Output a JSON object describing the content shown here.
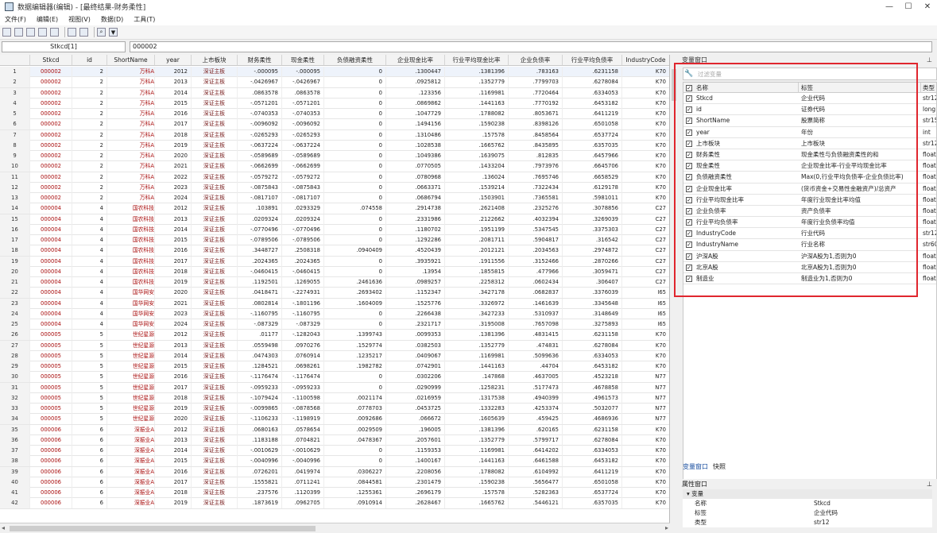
{
  "window": {
    "title": "数据编辑器(编辑) - [最终结果-财务柔性]"
  },
  "menu": [
    "文件(F)",
    "编辑(E)",
    "视图(V)",
    "数据(D)",
    "工具(T)"
  ],
  "varbar": {
    "varname": "Stkcd[1]",
    "value": "000002"
  },
  "columns": [
    "Stkcd",
    "id",
    "ShortName",
    "year",
    "上市板块",
    "财务柔性",
    "现金柔性",
    "负债融资柔性",
    "企业现金比率",
    "行业平均现金比率",
    "企业负债率",
    "行业平均负债率",
    "IndustryCode"
  ],
  "rows": [
    [
      "000002",
      "2",
      "万科A",
      "2012",
      "深证主板",
      "-.000095",
      "-.000095",
      "0",
      ".1300447",
      ".1381396",
      ".783163",
      ".6231158",
      "K70"
    ],
    [
      "000002",
      "2",
      "万科A",
      "2013",
      "深证主板",
      "-.0426967",
      "-.0426967",
      "0",
      ".0925812",
      ".1352779",
      ".7799703",
      ".6278084",
      "K70"
    ],
    [
      "000002",
      "2",
      "万科A",
      "2014",
      "深证主板",
      ".0863578",
      ".0863578",
      "0",
      ".123356",
      ".1169981",
      ".7720464",
      ".6334053",
      "K70"
    ],
    [
      "000002",
      "2",
      "万科A",
      "2015",
      "深证主板",
      "-.0571201",
      "-.0571201",
      "0",
      ".0869862",
      ".1441163",
      ".7770192",
      ".6453182",
      "K70"
    ],
    [
      "000002",
      "2",
      "万科A",
      "2016",
      "深证主板",
      "-.0740353",
      "-.0740353",
      "0",
      ".1047729",
      ".1788082",
      ".8053671",
      ".6411219",
      "K70"
    ],
    [
      "000002",
      "2",
      "万科A",
      "2017",
      "深证主板",
      "-.0096092",
      "-.0096092",
      "0",
      ".1494156",
      ".1590238",
      ".8398126",
      ".6501058",
      "K70"
    ],
    [
      "000002",
      "2",
      "万科A",
      "2018",
      "深证主板",
      "-.0265293",
      "-.0265293",
      "0",
      ".1310486",
      ".157578",
      ".8458564",
      ".6537724",
      "K70"
    ],
    [
      "000002",
      "2",
      "万科A",
      "2019",
      "深证主板",
      "-.0637224",
      "-.0637224",
      "0",
      ".1028538",
      ".1665762",
      ".8435895",
      ".6357035",
      "K70"
    ],
    [
      "000002",
      "2",
      "万科A",
      "2020",
      "深证主板",
      "-.0589689",
      "-.0589689",
      "0",
      ".1049386",
      ".1639075",
      ".812835",
      ".6457966",
      "K70"
    ],
    [
      "000002",
      "2",
      "万科A",
      "2021",
      "深证主板",
      "-.0662699",
      "-.0662699",
      "0",
      ".0770505",
      ".1433204",
      ".7973976",
      ".6645706",
      "K70"
    ],
    [
      "000002",
      "2",
      "万科A",
      "2022",
      "深证主板",
      "-.0579272",
      "-.0579272",
      "0",
      ".0780968",
      ".136024",
      ".7695746",
      ".6658529",
      "K70"
    ],
    [
      "000002",
      "2",
      "万科A",
      "2023",
      "深证主板",
      "-.0875843",
      "-.0875843",
      "0",
      ".0663371",
      ".1539214",
      ".7322434",
      ".6129178",
      "K70"
    ],
    [
      "000002",
      "2",
      "万科A",
      "2024",
      "深证主板",
      "-.0817107",
      "-.0817107",
      "0",
      ".0686794",
      ".1503901",
      ".7365581",
      ".5981011",
      "K70"
    ],
    [
      "000004",
      "4",
      "国农科技",
      "2012",
      "深证主板",
      ".103891",
      ".0293329",
      ".074558",
      ".2914738",
      ".2621408",
      ".2325276",
      ".3078856",
      "C27"
    ],
    [
      "000004",
      "4",
      "国农科技",
      "2013",
      "深证主板",
      ".0209324",
      ".0209324",
      "0",
      ".2331986",
      ".2122662",
      ".4032394",
      ".3269039",
      "C27"
    ],
    [
      "000004",
      "4",
      "国农科技",
      "2014",
      "深证主板",
      "-.0770496",
      "-.0770496",
      "0",
      ".1180702",
      ".1951199",
      ".5347545",
      ".3375303",
      "C27"
    ],
    [
      "000004",
      "4",
      "国农科技",
      "2015",
      "深证主板",
      "-.0789506",
      "-.0789506",
      "0",
      ".1292286",
      ".2081711",
      ".5904817",
      ".316542",
      "C27"
    ],
    [
      "000004",
      "4",
      "国农科技",
      "2016",
      "深证主板",
      ".3448727",
      ".2508318",
      ".0940409",
      ".4520439",
      ".2012121",
      ".2034563",
      ".2974872",
      "C27"
    ],
    [
      "000004",
      "4",
      "国农科技",
      "2017",
      "深证主板",
      ".2024365",
      ".2024365",
      "0",
      ".3935921",
      ".1911556",
      ".3152466",
      ".2870266",
      "C27"
    ],
    [
      "000004",
      "4",
      "国农科技",
      "2018",
      "深证主板",
      "-.0460415",
      "-.0460415",
      "0",
      ".13954",
      ".1855815",
      ".477966",
      ".3059471",
      "C27"
    ],
    [
      "000004",
      "4",
      "国农科技",
      "2019",
      "深证主板",
      ".1192501",
      ".1269055",
      ".2461636",
      ".0989257",
      ".2258312",
      ".0602434",
      ".306407",
      "C27"
    ],
    [
      "000004",
      "4",
      "国华网安",
      "2020",
      "深证主板",
      ".0418471",
      "-.2274931",
      ".2693402",
      ".1152347",
      ".3427178",
      ".0682837",
      ".3376039",
      "I65"
    ],
    [
      "000004",
      "4",
      "国华网安",
      "2021",
      "深证主板",
      ".0802814",
      "-.1801196",
      ".1604009",
      ".1525776",
      ".3326972",
      ".1461639",
      ".3345648",
      "I65"
    ],
    [
      "000004",
      "4",
      "国华网安",
      "2023",
      "深证主板",
      "-.1160795",
      "-.1160795",
      "0",
      ".2266438",
      ".3427233",
      ".5310937",
      ".3148649",
      "I65"
    ],
    [
      "000004",
      "4",
      "国华网安",
      "2024",
      "深证主板",
      "-.087329",
      "-.087329",
      "0",
      ".2321717",
      ".3195008",
      ".7657098",
      ".3275893",
      "I65"
    ],
    [
      "000005",
      "5",
      "世纪星源",
      "2012",
      "深证主板",
      ".01177",
      "-.1282043",
      ".1399743",
      ".0099353",
      ".1381396",
      ".4831415",
      ".6231158",
      "K70"
    ],
    [
      "000005",
      "5",
      "世纪星源",
      "2013",
      "深证主板",
      ".0559498",
      ".0970276",
      ".1529774",
      ".0382503",
      ".1352779",
      ".474831",
      ".6278084",
      "K70"
    ],
    [
      "000005",
      "5",
      "世纪星源",
      "2014",
      "深证主板",
      ".0474303",
      ".0760914",
      ".1235217",
      ".0409067",
      ".1169981",
      ".5099636",
      ".6334053",
      "K70"
    ],
    [
      "000005",
      "5",
      "世纪星源",
      "2015",
      "深证主板",
      ".1284521",
      ".0698261",
      ".1982782",
      ".0742901",
      ".1441163",
      ".44704",
      ".6453182",
      "K70"
    ],
    [
      "000005",
      "5",
      "世纪星源",
      "2016",
      "深证主板",
      "-.1176474",
      "-.1176474",
      "0",
      ".0302206",
      ".147868",
      ".4637005",
      ".4523218",
      "N77"
    ],
    [
      "000005",
      "5",
      "世纪星源",
      "2017",
      "深证主板",
      "-.0959233",
      "-.0959233",
      "0",
      ".0290999",
      ".1258231",
      ".5177473",
      ".4678858",
      "N77"
    ],
    [
      "000005",
      "5",
      "世纪星源",
      "2018",
      "深证主板",
      "-.1079424",
      "-.1100598",
      ".0021174",
      ".0216959",
      ".1317538",
      ".4940399",
      ".4961573",
      "N77"
    ],
    [
      "000005",
      "5",
      "世纪星源",
      "2019",
      "深证主板",
      "-.0099865",
      "-.0878568",
      ".0778703",
      ".0453725",
      ".1332283",
      ".4253374",
      ".5032077",
      "N77"
    ],
    [
      "000005",
      "5",
      "世纪星源",
      "2020",
      "深证主板",
      "-.1106233",
      "-.1198919",
      ".0092686",
      ".066672",
      ".1605639",
      ".459425",
      ".4686936",
      "N77"
    ],
    [
      "000006",
      "6",
      "深振业A",
      "2012",
      "深证主板",
      ".0680163",
      ".0578654",
      ".0029509",
      ".196005",
      ".1381396",
      ".620165",
      ".6231158",
      "K70"
    ],
    [
      "000006",
      "6",
      "深振业A",
      "2013",
      "深证主板",
      ".1183188",
      ".0704821",
      ".0478367",
      ".2057601",
      ".1352779",
      ".5799717",
      ".6278084",
      "K70"
    ],
    [
      "000006",
      "6",
      "深振业A",
      "2014",
      "深证主板",
      "-.0010629",
      "-.0010629",
      "0",
      ".1159353",
      ".1169981",
      ".6414202",
      ".6334053",
      "K70"
    ],
    [
      "000006",
      "6",
      "深振业A",
      "2015",
      "深证主板",
      "-.0040996",
      "-.0040996",
      "0",
      ".1400167",
      ".1441163",
      ".6461588",
      ".6453182",
      "K70"
    ],
    [
      "000006",
      "6",
      "深振业A",
      "2016",
      "深证主板",
      ".0726201",
      ".0419974",
      ".0306227",
      ".2208056",
      ".1788082",
      ".6104992",
      ".6411219",
      "K70"
    ],
    [
      "000006",
      "6",
      "深振业A",
      "2017",
      "深证主板",
      ".1555821",
      ".0711241",
      ".0844581",
      ".2301479",
      ".1590238",
      ".5656477",
      ".6501058",
      "K70"
    ],
    [
      "000006",
      "6",
      "深振业A",
      "2018",
      "深证主板",
      ".237576",
      ".1120399",
      ".1255361",
      ".2696179",
      ".157578",
      ".5282363",
      ".6537724",
      "K70"
    ],
    [
      "000006",
      "6",
      "深振业A",
      "2019",
      "深证主板",
      ".1873619",
      ".0962705",
      ".0910914",
      ".2628467",
      ".1665762",
      ".5446121",
      ".6357035",
      "K70"
    ]
  ],
  "vars_panel": {
    "title": "变量窗口",
    "filter_placeholder": "过滤变量",
    "headers": {
      "name": "名称",
      "label": "标签",
      "type": "类型"
    },
    "vars": [
      {
        "name": "Stkcd",
        "label": "企业代码",
        "type": "str12"
      },
      {
        "name": "id",
        "label": "证券代码",
        "type": "long"
      },
      {
        "name": "ShortName",
        "label": "股票简称",
        "type": "str15"
      },
      {
        "name": "year",
        "label": "年份",
        "type": "int"
      },
      {
        "name": "上市板块",
        "label": "上市板块",
        "type": "str12"
      },
      {
        "name": "财务柔性",
        "label": "现金柔性与负债融资柔性的和",
        "type": "float"
      },
      {
        "name": "现金柔性",
        "label": "企业现金比率-行业平均现金比率",
        "type": "float"
      },
      {
        "name": "负债融资柔性",
        "label": "Max(0,行业平均负债率-企业负债比率)",
        "type": "float"
      },
      {
        "name": "企业现金比率",
        "label": "(货币资金+交易性金融资产)/总资产",
        "type": "float"
      },
      {
        "name": "行业平均现金比率",
        "label": "年度行业现金比率均值",
        "type": "float"
      },
      {
        "name": "企业负债率",
        "label": "资产负债率",
        "type": "float"
      },
      {
        "name": "行业平均负债率",
        "label": "年度行业负债率均值",
        "type": "float"
      },
      {
        "name": "IndustryCode",
        "label": "行业代码",
        "type": "str12"
      },
      {
        "name": "IndustryName",
        "label": "行业名称",
        "type": "str60"
      },
      {
        "name": "沪深A股",
        "label": "沪深A股为1,否则为0",
        "type": "float"
      },
      {
        "name": "北京A股",
        "label": "北京A股为1,否则为0",
        "type": "float"
      },
      {
        "name": "制造业",
        "label": "制造业为1,否则为0",
        "type": "float"
      }
    ],
    "tabs": [
      "变量窗口",
      "快照"
    ]
  },
  "props_panel": {
    "title": "属性窗口",
    "group": "变量",
    "rows": [
      {
        "k": "名称",
        "v": "Stkcd"
      },
      {
        "k": "标签",
        "v": "企业代码"
      },
      {
        "k": "类型",
        "v": "str12"
      }
    ]
  }
}
